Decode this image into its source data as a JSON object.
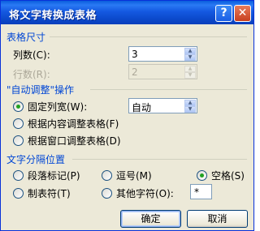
{
  "window": {
    "title": "将文字转换成表格",
    "help_label": "?",
    "close_label": "✕"
  },
  "table_size": {
    "group_label": "表格尺寸",
    "columns_label": "列数(C):",
    "columns_value": "3",
    "rows_label": "行数(R):",
    "rows_value": "2"
  },
  "autofit": {
    "group_label": "\"自动调整\"操作",
    "fixed_width_label": "固定列宽(W):",
    "fixed_width_value": "自动",
    "fit_contents_label": "根据内容调整表格(F)",
    "fit_window_label": "根据窗口调整表格(D)",
    "selected": "fixed_width"
  },
  "separator": {
    "group_label": "文字分隔位置",
    "paragraph_label": "段落标记(P)",
    "comma_label": "逗号(M)",
    "space_label": "空格(S)",
    "tab_label": "制表符(T)",
    "other_label": "其他字符(O):",
    "other_value": "*",
    "selected": "space"
  },
  "buttons": {
    "ok_label": "确定",
    "cancel_label": "取消"
  }
}
